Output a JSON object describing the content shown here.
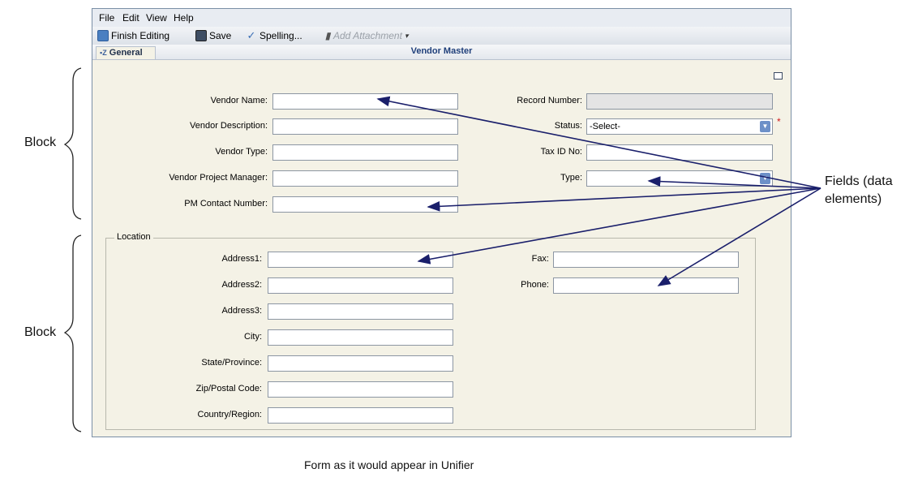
{
  "menu": [
    "File",
    "Edit",
    "View",
    "Help"
  ],
  "toolbar": {
    "finish_editing": "Finish Editing",
    "save": "Save",
    "spelling": "Spelling...",
    "add_attachment": "Add Attachment",
    "dropdown": "▾"
  },
  "tab": {
    "label": "General"
  },
  "form_title": "Vendor Master",
  "fields": {
    "vendor_name": "Vendor Name:",
    "vendor_description": "Vendor Description:",
    "vendor_type": "Vendor Type:",
    "vendor_project_manager": "Vendor Project Manager:",
    "pm_contact_number": "PM Contact Number:",
    "record_number": "Record Number:",
    "status": "Status:",
    "status_value": "-Select-",
    "tax_id": "Tax ID No:",
    "type": "Type:"
  },
  "location": {
    "legend": "Location",
    "address1": "Address1:",
    "address2": "Address2:",
    "address3": "Address3:",
    "city": "City:",
    "state": "State/Province:",
    "zip": "Zip/Postal Code:",
    "country": "Country/Region:",
    "fax": "Fax:",
    "phone": "Phone:"
  },
  "annotations": {
    "block_top": "Block",
    "block_bottom": "Block",
    "fields_line1": "Fields (data",
    "fields_line2": "elements)"
  },
  "caption": "Form as it would appear in Unifier",
  "colors": {
    "arrow": "#1a1f6b",
    "required": "#d01a1a",
    "title": "#1f3f7a"
  }
}
